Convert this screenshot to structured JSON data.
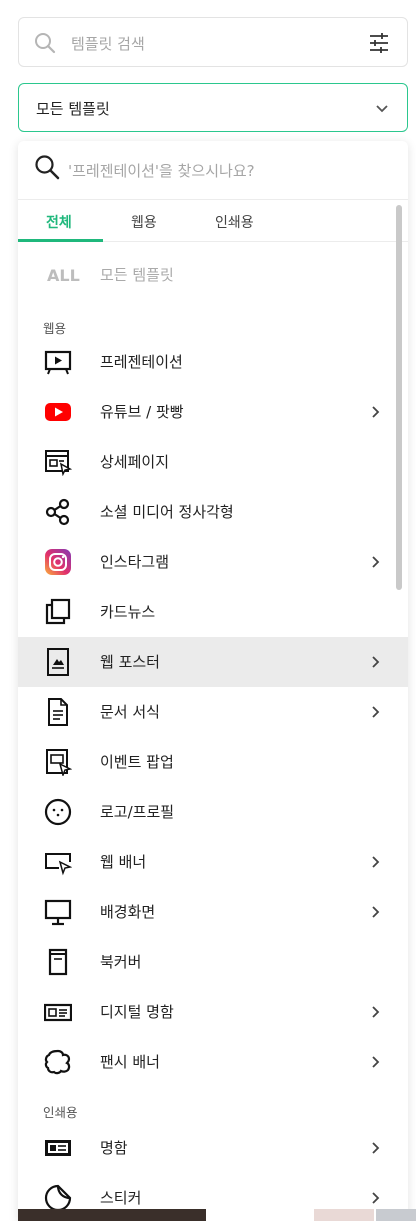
{
  "search": {
    "placeholder": "템플릿 검색"
  },
  "select": {
    "value": "모든 템플릿"
  },
  "panel": {
    "search_placeholder": "'프레젠테이션'을 찾으시나요?",
    "tabs": [
      {
        "label": "전체",
        "active": true
      },
      {
        "label": "웹용",
        "active": false
      },
      {
        "label": "인쇄용",
        "active": false
      }
    ],
    "all_badge": "ALL",
    "all_label": "모든 템플릿",
    "section_web": "웹용",
    "section_print": "인쇄용",
    "web_items": [
      {
        "label": "프레젠테이션",
        "icon": "presentation-icon",
        "arrow": false
      },
      {
        "label": "유튜브 / 팟빵",
        "icon": "youtube-icon",
        "arrow": true
      },
      {
        "label": "상세페이지",
        "icon": "detail-page-icon",
        "arrow": false
      },
      {
        "label": "소셜 미디어 정사각형",
        "icon": "share-icon",
        "arrow": false
      },
      {
        "label": "인스타그램",
        "icon": "instagram-icon",
        "arrow": true
      },
      {
        "label": "카드뉴스",
        "icon": "card-news-icon",
        "arrow": false
      },
      {
        "label": "웹 포스터",
        "icon": "poster-icon",
        "arrow": true,
        "highlighted": true
      },
      {
        "label": "문서 서식",
        "icon": "document-icon",
        "arrow": true
      },
      {
        "label": "이벤트 팝업",
        "icon": "popup-icon",
        "arrow": false
      },
      {
        "label": "로고/프로필",
        "icon": "logo-profile-icon",
        "arrow": false
      },
      {
        "label": "웹 배너",
        "icon": "web-banner-icon",
        "arrow": true
      },
      {
        "label": "배경화면",
        "icon": "monitor-icon",
        "arrow": true
      },
      {
        "label": "북커버",
        "icon": "book-cover-icon",
        "arrow": false
      },
      {
        "label": "디지털 명함",
        "icon": "digital-card-icon",
        "arrow": true
      },
      {
        "label": "팬시 배너",
        "icon": "fancy-banner-icon",
        "arrow": true
      }
    ],
    "print_items": [
      {
        "label": "명함",
        "icon": "business-card-icon",
        "arrow": true
      },
      {
        "label": "스티커",
        "icon": "sticker-icon",
        "arrow": true
      }
    ]
  },
  "colors": {
    "accent": "#1fb87c",
    "border_active": "#2bc78e",
    "highlight": "#ebebeb"
  }
}
